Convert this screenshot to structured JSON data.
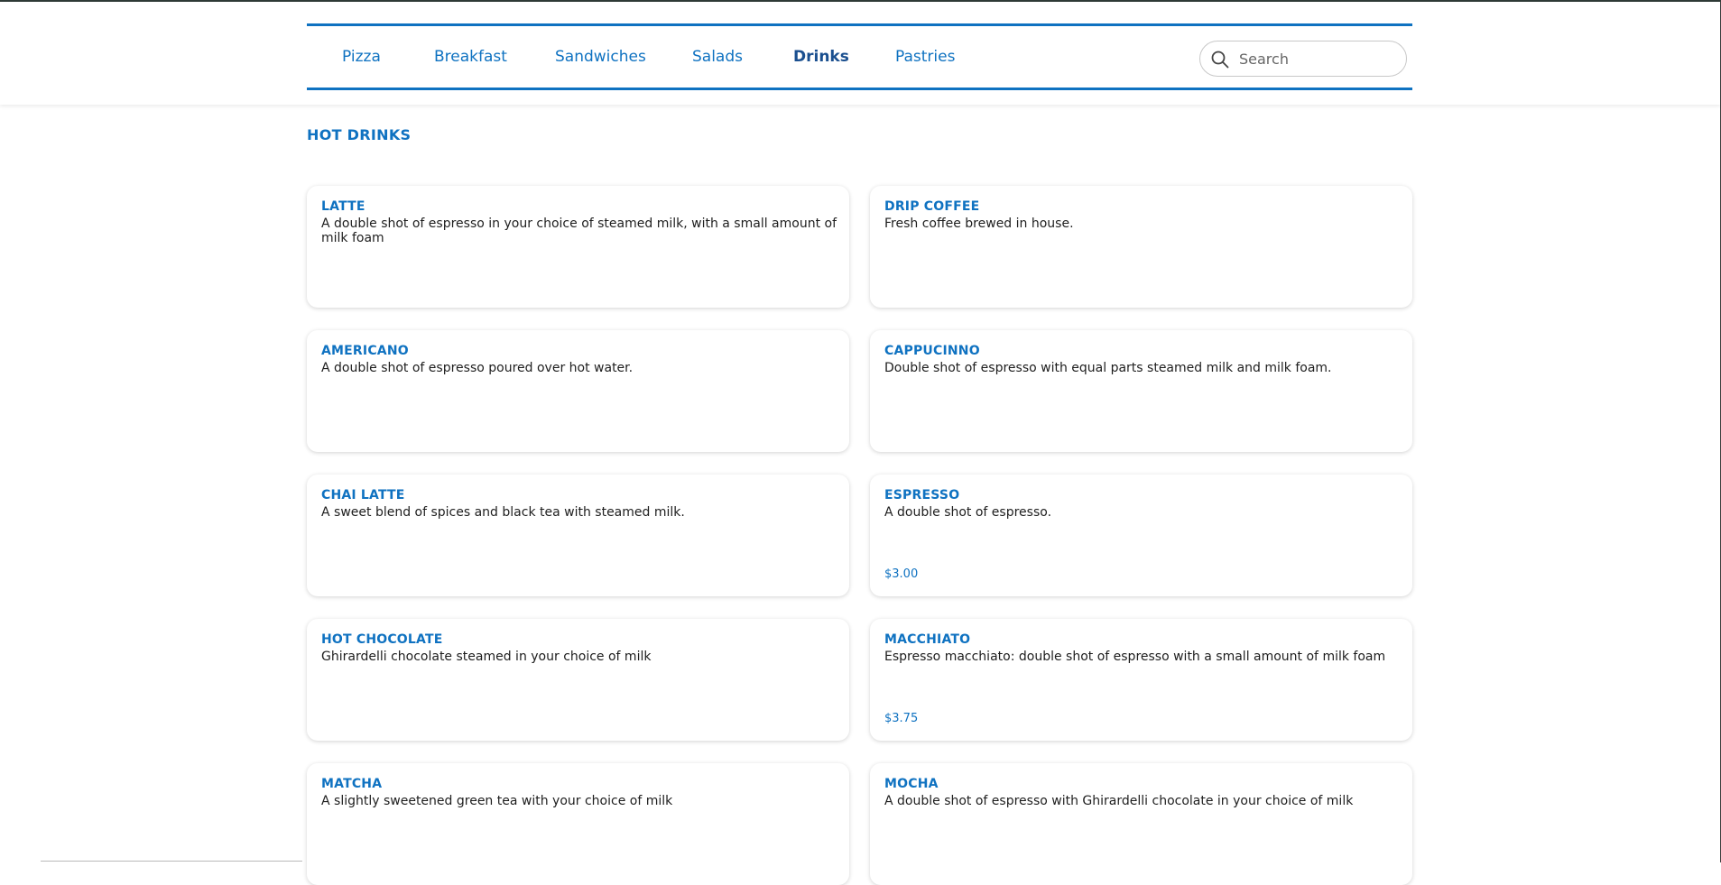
{
  "nav": {
    "items": [
      {
        "label": "Pizza",
        "active": false
      },
      {
        "label": "Breakfast",
        "active": false
      },
      {
        "label": "Sandwiches",
        "active": false
      },
      {
        "label": "Salads",
        "active": false
      },
      {
        "label": "Drinks",
        "active": true
      },
      {
        "label": "Pastries",
        "active": false
      }
    ],
    "search_placeholder": "Search"
  },
  "section": {
    "title": "HOT DRINKS"
  },
  "items": [
    {
      "name": "LATTE",
      "description": "A double shot of espresso in your choice of steamed milk, with a small amount of milk foam",
      "price": ""
    },
    {
      "name": "DRIP COFFEE",
      "description": "Fresh coffee brewed in house.",
      "price": ""
    },
    {
      "name": "AMERICANO",
      "description": "A double shot of espresso poured over hot water.",
      "price": ""
    },
    {
      "name": "CAPPUCINNO",
      "description": "Double shot of espresso with equal parts steamed milk and milk foam.",
      "price": ""
    },
    {
      "name": "CHAI LATTE",
      "description": "A sweet blend of spices and black tea with steamed milk.",
      "price": ""
    },
    {
      "name": "ESPRESSO",
      "description": "A double shot of espresso.",
      "price": "$3.00"
    },
    {
      "name": "HOT CHOCOLATE",
      "description": "Ghirardelli chocolate steamed in your choice of milk",
      "price": ""
    },
    {
      "name": "MACCHIATO",
      "description": "Espresso macchiato: double shot of espresso with a small amount of milk foam",
      "price": "$3.75"
    },
    {
      "name": "MATCHA",
      "description": "A slightly sweetened green tea with your choice of milk",
      "price": ""
    },
    {
      "name": "MOCHA",
      "description": "A double shot of espresso with Ghirardelli chocolate in your choice of milk",
      "price": ""
    }
  ],
  "colors": {
    "accent": "#0f72c1",
    "active_nav": "#1a4f8f"
  }
}
